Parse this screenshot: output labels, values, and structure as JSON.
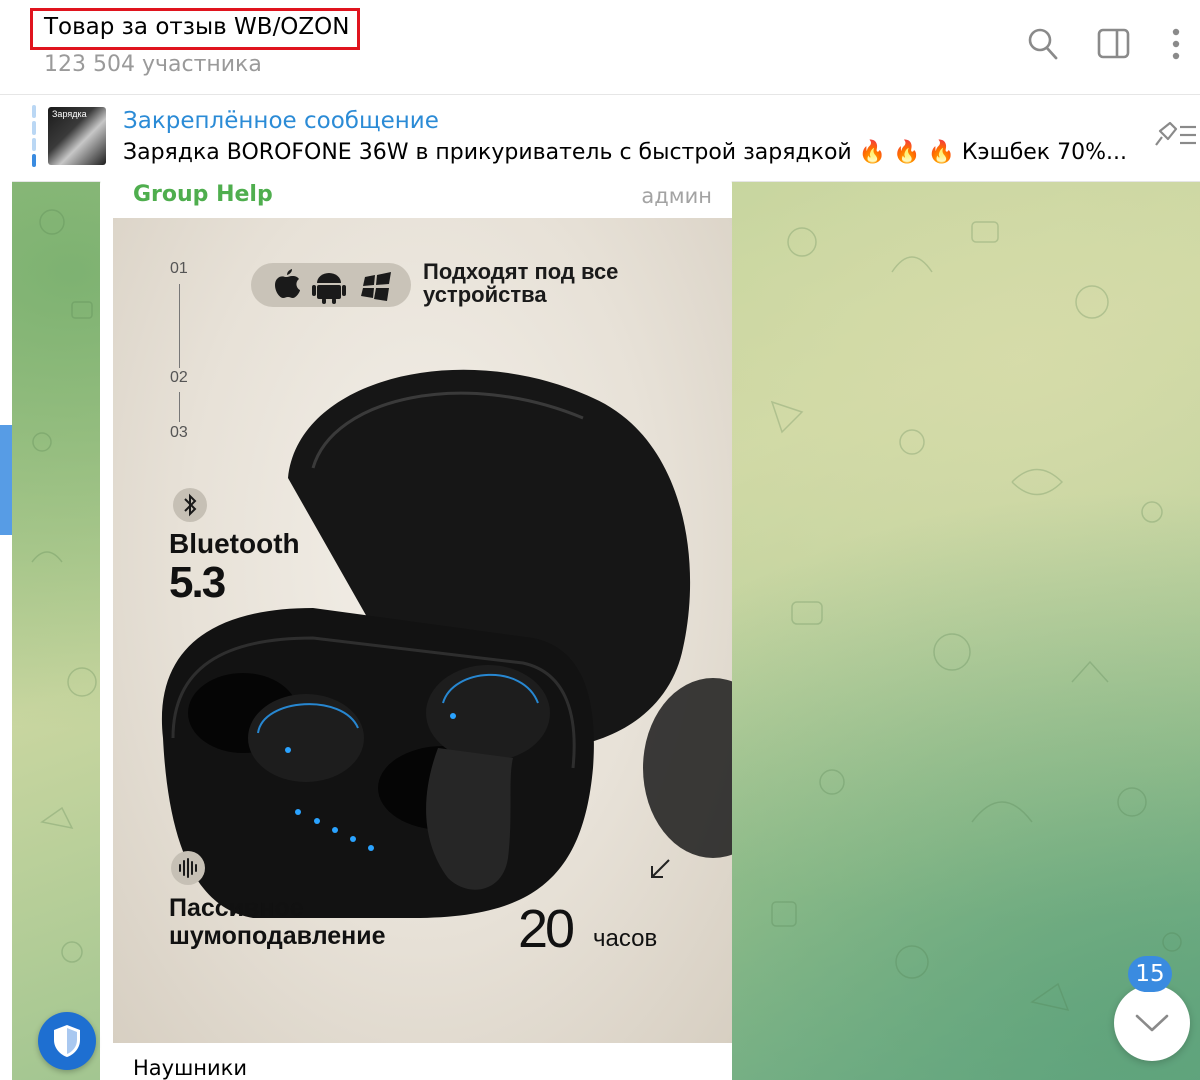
{
  "header": {
    "title": "Товар за отзыв WB/OZON",
    "subtitle": "123 504 участника",
    "highlight_color": "#e0141e",
    "icons": [
      "search-icon",
      "sidebar-toggle-icon",
      "more-vertical-icon"
    ]
  },
  "pinned": {
    "title": "Закреплённое сообщение",
    "text": "Зарядка BOROFONE 36W в прикуриватель с быстрой зарядкой 🔥 🔥 🔥 Кэшбек 70%...",
    "thumb_label": "Зарядка",
    "icon": "pin-list-icon"
  },
  "message": {
    "sender": "Group Help",
    "sender_color": "#4fae4e",
    "role": "админ",
    "caption": "Наушники",
    "photo": {
      "steps": [
        "01",
        "02",
        "03"
      ],
      "devices": [
        "Подходят под все",
        "устройства"
      ],
      "os_icons": [
        "apple-icon",
        "android-icon",
        "windows-icon"
      ],
      "bluetooth_label": "Bluetooth",
      "bluetooth_version": "5.3",
      "noise_lines": [
        "Пассивное",
        "шумоподавление"
      ],
      "hours_value": "20",
      "hours_unit": "часов"
    }
  },
  "scroll_down": {
    "unread_count": "15",
    "icon": "chevron-down-icon"
  },
  "shield": {
    "icon": "shield-icon"
  },
  "accent_color": "#3a8be0"
}
